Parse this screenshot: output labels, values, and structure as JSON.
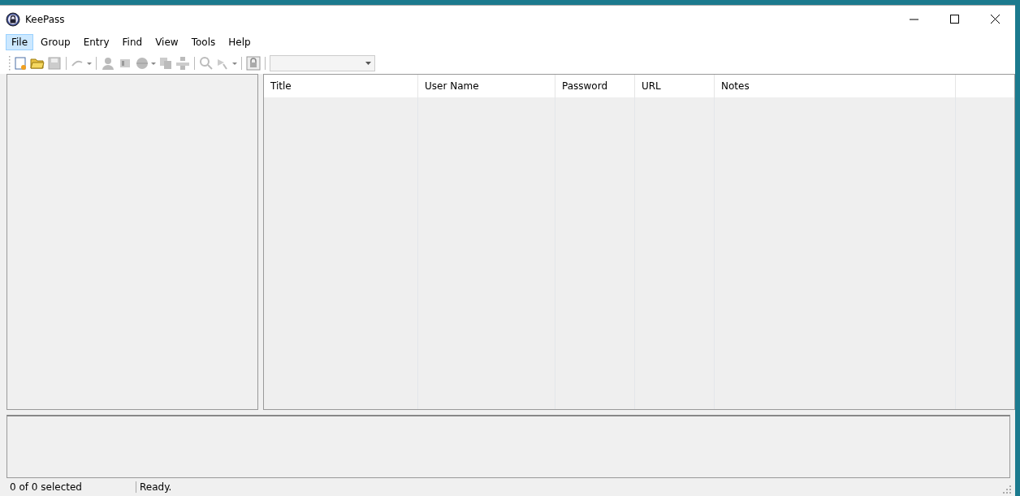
{
  "window": {
    "title": "KeePass"
  },
  "menu": [
    {
      "label": "File",
      "selected": true
    },
    {
      "label": "Group",
      "selected": false
    },
    {
      "label": "Entry",
      "selected": false
    },
    {
      "label": "Find",
      "selected": false
    },
    {
      "label": "View",
      "selected": false
    },
    {
      "label": "Tools",
      "selected": false
    },
    {
      "label": "Help",
      "selected": false
    }
  ],
  "entry_list": {
    "columns": [
      "Title",
      "User Name",
      "Password",
      "URL",
      "Notes"
    ]
  },
  "status_bar": [
    "0 of 0 selected",
    "Ready."
  ]
}
